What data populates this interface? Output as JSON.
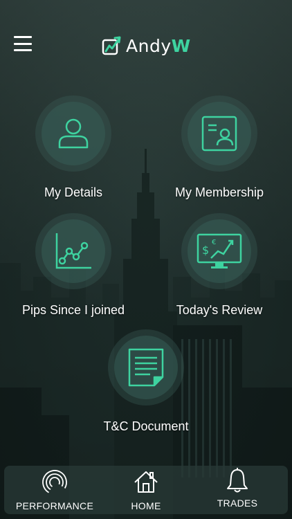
{
  "app": {
    "logo_text_main": "Andy",
    "logo_text_accent": "W",
    "accent_color": "#3ed3a0"
  },
  "menu": {
    "icon": "hamburger-menu-icon"
  },
  "tiles": [
    {
      "label": "My Details",
      "icon": "user-icon"
    },
    {
      "label": "My Membership",
      "icon": "membership-card-icon"
    },
    {
      "label": "Pips Since I joined",
      "icon": "line-chart-icon"
    },
    {
      "label": "Today's Review",
      "icon": "trading-monitor-icon"
    },
    {
      "label": "T&C Document",
      "icon": "document-icon"
    }
  ],
  "tabbar": {
    "tabs": [
      {
        "label": "PERFORMANCE",
        "icon": "performance-rings-icon"
      },
      {
        "label": "HOME",
        "icon": "home-icon"
      },
      {
        "label": "TRADES",
        "icon": "bell-icon"
      }
    ]
  }
}
